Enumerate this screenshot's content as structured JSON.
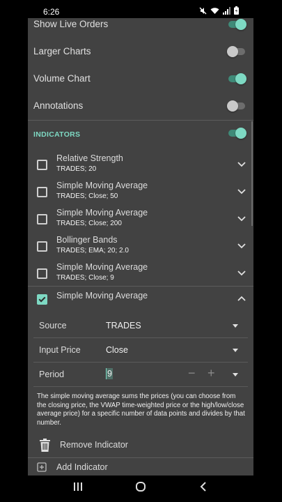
{
  "status_bar": {
    "time": "6:26"
  },
  "settings": {
    "toggles": [
      {
        "label": "Show Live Orders",
        "on": true
      },
      {
        "label": "Larger Charts",
        "on": false
      },
      {
        "label": "Volume Chart",
        "on": true
      },
      {
        "label": "Annotations",
        "on": false
      }
    ],
    "indicators_header": "INDICATORS",
    "indicators_on": true
  },
  "indicators": [
    {
      "name": "Relative Strength",
      "params": "TRADES; 20",
      "checked": false
    },
    {
      "name": "Simple Moving Average",
      "params": "TRADES; Close; 50",
      "checked": false
    },
    {
      "name": "Simple Moving Average",
      "params": "TRADES; Close; 200",
      "checked": false
    },
    {
      "name": "Bollinger Bands",
      "params": "TRADES; EMA; 20; 2.0",
      "checked": false
    },
    {
      "name": "Simple Moving Average",
      "params": "TRADES; Close; 9",
      "checked": false
    }
  ],
  "expanded_indicator": {
    "name": "Simple Moving Average",
    "checked": true,
    "fields": {
      "source_label": "Source",
      "source_value": "TRADES",
      "input_price_label": "Input Price",
      "input_price_value": "Close",
      "period_label": "Period",
      "period_value": "9",
      "minus": "−",
      "plus": "+"
    },
    "description": "The simple moving average sums the prices (you can choose from the closing price, the VWAP time-weighted price or the high/low/close average price) for a specific number of data points and divides by that number."
  },
  "actions": {
    "remove_label": "Remove Indicator",
    "add_label": "Add Indicator"
  },
  "colors": {
    "accent": "#7ed9c3",
    "panel": "#424242"
  }
}
